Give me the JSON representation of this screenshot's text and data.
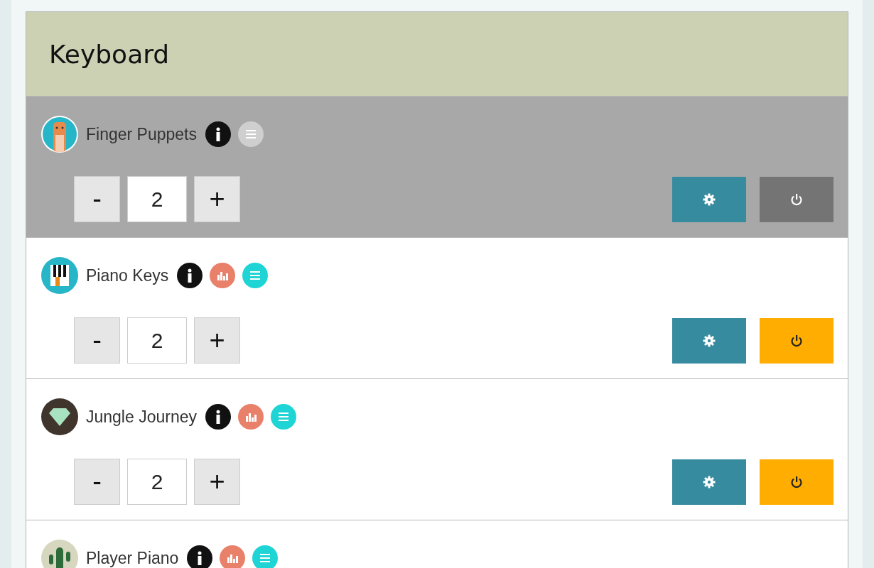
{
  "title": "Keyboard",
  "activities": [
    {
      "name": "Finger Puppets",
      "avatar": {
        "kind": "cat"
      },
      "enabled": false,
      "badges": [
        {
          "kind": "info"
        },
        {
          "kind": "list"
        }
      ],
      "decrement": "-",
      "count": "2",
      "increment": "+"
    },
    {
      "name": "Piano Keys",
      "avatar": {
        "kind": "piano"
      },
      "enabled": true,
      "badges": [
        {
          "kind": "info"
        },
        {
          "kind": "stats"
        },
        {
          "kind": "list"
        }
      ],
      "decrement": "-",
      "count": "2",
      "increment": "+"
    },
    {
      "name": "Jungle Journey",
      "avatar": {
        "kind": "gem"
      },
      "enabled": true,
      "badges": [
        {
          "kind": "info"
        },
        {
          "kind": "stats"
        },
        {
          "kind": "list"
        }
      ],
      "decrement": "-",
      "count": "2",
      "increment": "+"
    },
    {
      "name": "Player Piano",
      "avatar": {
        "kind": "cactus"
      },
      "enabled": true,
      "badges": [
        {
          "kind": "info"
        },
        {
          "kind": "stats"
        },
        {
          "kind": "list"
        }
      ]
    }
  ]
}
